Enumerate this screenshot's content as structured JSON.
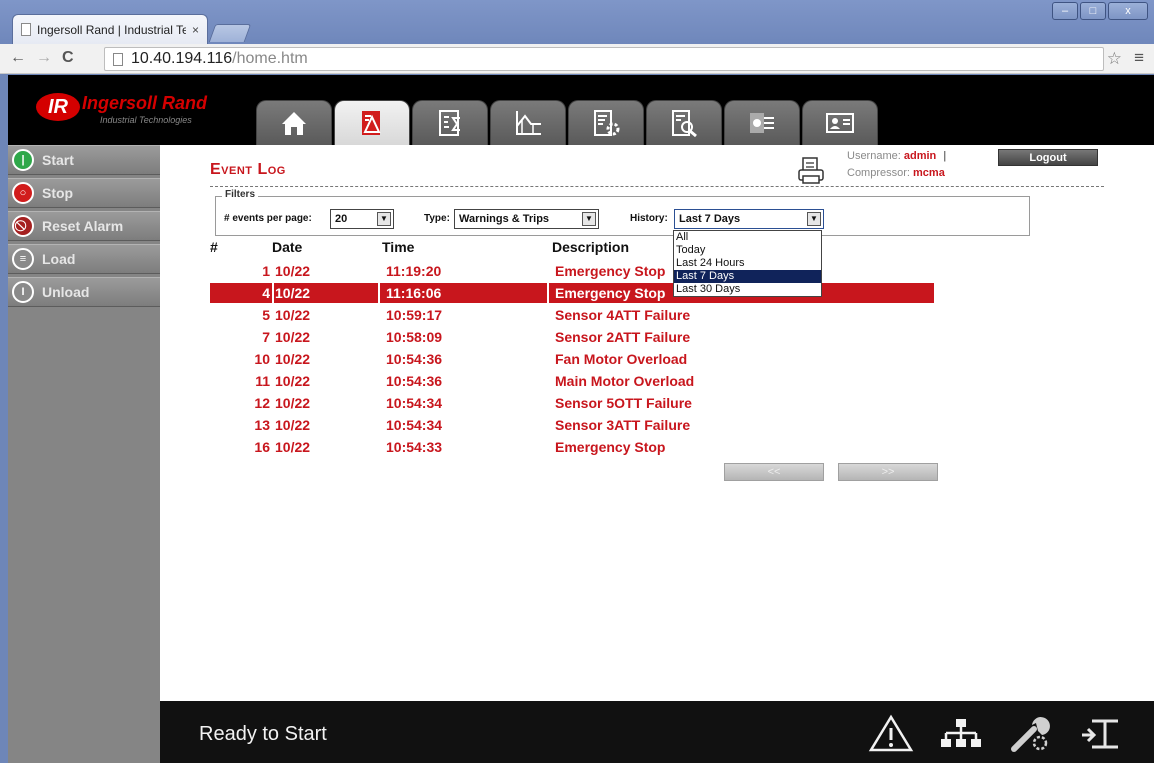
{
  "browser": {
    "tab_title": "Ingersoll Rand | Industrial Te",
    "tab_close": "×",
    "url_host": "10.40.194.116",
    "url_path": "/home.htm",
    "window_buttons": [
      "–",
      "□",
      "x"
    ]
  },
  "header": {
    "logo_mark": "IR",
    "brand": "Ingersoll Rand",
    "brand_sub": "Industrial Technologies",
    "nav_tabs": [
      {
        "icon": "home-icon"
      },
      {
        "icon": "alarm-log-icon"
      },
      {
        "icon": "summary-icon"
      },
      {
        "icon": "trend-icon"
      },
      {
        "icon": "settings-sheet-icon"
      },
      {
        "icon": "search-log-icon"
      },
      {
        "icon": "service-icon"
      },
      {
        "icon": "contact-card-icon"
      }
    ],
    "active_tab": 1
  },
  "sidebar": {
    "items": [
      {
        "label": "Start",
        "icon": "start-icon",
        "color": "#2fa84a"
      },
      {
        "label": "Stop",
        "icon": "stop-icon",
        "color": "#d11c1c"
      },
      {
        "label": "Reset Alarm",
        "icon": "reset-alarm-icon",
        "color": "#d11c1c"
      },
      {
        "label": "Load",
        "icon": "load-icon",
        "color": "#8a8a8a"
      },
      {
        "label": "Unload",
        "icon": "unload-icon",
        "color": "#8a8a8a"
      }
    ]
  },
  "page": {
    "title": "Event Log",
    "username_label": "Username:",
    "username": "admin",
    "compressor_label": "Compressor:",
    "compressor": "mcma",
    "separator": "|",
    "logout": "Logout"
  },
  "filters": {
    "legend": "Filters",
    "events_label": "# events per page:",
    "events_value": "20",
    "type_label": "Type:",
    "type_value": "Warnings & Trips",
    "history_label": "History:",
    "history_value": "Last 7 Days",
    "history_options": [
      "All",
      "Today",
      "Last 24 Hours",
      "Last 7 Days",
      "Last 30 Days"
    ],
    "history_selected_index": 3
  },
  "table": {
    "headers": {
      "num": "#",
      "date": "Date",
      "time": "Time",
      "description": "Description"
    },
    "rows": [
      {
        "num": "1",
        "date": "10/22",
        "time": "11:19:20",
        "description": "Emergency Stop"
      },
      {
        "num": "4",
        "date": "10/22",
        "time": "11:16:06",
        "description": "Emergency Stop"
      },
      {
        "num": "5",
        "date": "10/22",
        "time": "10:59:17",
        "description": "Sensor 4ATT Failure"
      },
      {
        "num": "7",
        "date": "10/22",
        "time": "10:58:09",
        "description": "Sensor 2ATT Failure"
      },
      {
        "num": "10",
        "date": "10/22",
        "time": "10:54:36",
        "description": "Fan Motor Overload"
      },
      {
        "num": "11",
        "date": "10/22",
        "time": "10:54:36",
        "description": "Main Motor Overload"
      },
      {
        "num": "12",
        "date": "10/22",
        "time": "10:54:34",
        "description": "Sensor 5OTT Failure"
      },
      {
        "num": "13",
        "date": "10/22",
        "time": "10:54:34",
        "description": "Sensor 3ATT Failure"
      },
      {
        "num": "16",
        "date": "10/22",
        "time": "10:54:33",
        "description": "Emergency Stop"
      }
    ],
    "highlighted_row": 1,
    "prev_label": "<<",
    "next_label": ">>"
  },
  "footer": {
    "status": "Ready to Start",
    "icons": [
      "warning-icon",
      "network-icon",
      "maintenance-icon",
      "load-unload-icon"
    ]
  },
  "colors": {
    "brand_red": "#c8161d",
    "header_bg": "#000000",
    "sidebar_bg": "#858585",
    "selection_bg": "#10235a"
  }
}
